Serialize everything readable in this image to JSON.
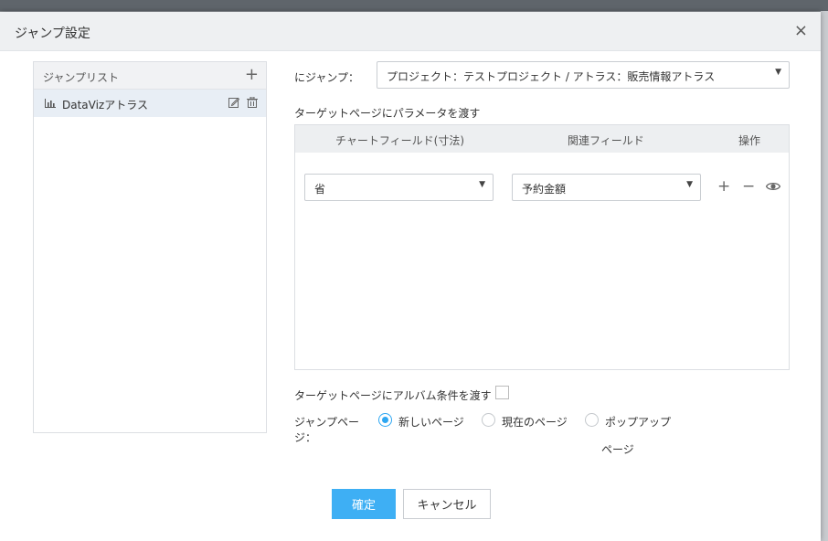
{
  "dialog": {
    "title": "ジャンプ設定",
    "close": "×"
  },
  "jump_list": {
    "title": "ジャンプリスト",
    "add": "+",
    "items": [
      {
        "label": "DataVizアトラス",
        "icon": "bar-chart-icon"
      }
    ]
  },
  "jump_to": {
    "label": "にジャンプ：",
    "value": "プロジェクト：テストプロジェクト / アトラス：販売情報アトラス"
  },
  "params": {
    "label": "ターゲットページにパラメータを渡す",
    "headers": [
      "チャートフィールド(寸法)",
      "関連フィールド",
      "操作"
    ],
    "rows": [
      {
        "chart_field": "省",
        "related_field": "予約金額"
      }
    ]
  },
  "album": {
    "label": "ターゲットページにアルバム条件を渡す",
    "checked": false
  },
  "jump_page": {
    "label_line1": "ジャンプペー",
    "label_line2": "ジ：",
    "options": [
      "新しいページ",
      "現在のページ",
      "ポップアップ"
    ],
    "option3_wrap": "ページ",
    "selected": "新しいページ"
  },
  "buttons": {
    "ok": "確定",
    "cancel": "キャンセル"
  },
  "colors": {
    "accent": "#3eaff4",
    "header_bg": "#eef0f2"
  }
}
